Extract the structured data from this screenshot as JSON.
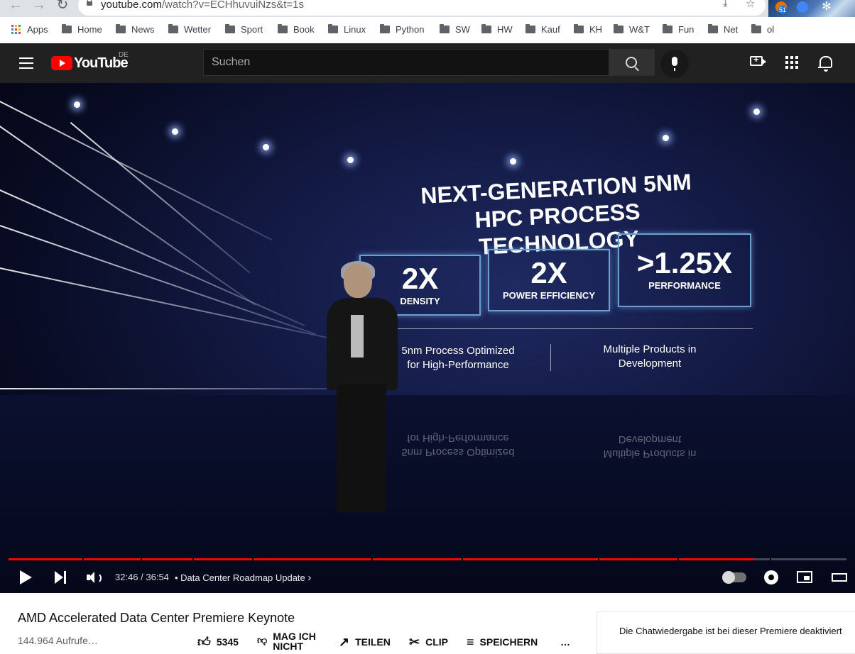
{
  "browser": {
    "url_host": "youtube.com",
    "url_path": "/watch?v=ECHhuvuiNzs&t=1s",
    "extension_badge": "51"
  },
  "bookmarks": [
    {
      "label": "Apps",
      "name": "bookmark-apps"
    },
    {
      "label": "Home",
      "name": "bookmark-home"
    },
    {
      "label": "News",
      "name": "bookmark-news"
    },
    {
      "label": "Wetter",
      "name": "bookmark-wetter"
    },
    {
      "label": "Sport",
      "name": "bookmark-sport"
    },
    {
      "label": "Book",
      "name": "bookmark-book"
    },
    {
      "label": "Linux",
      "name": "bookmark-linux"
    },
    {
      "label": "Python",
      "name": "bookmark-python"
    },
    {
      "label": "SW",
      "name": "bookmark-sw"
    },
    {
      "label": "HW",
      "name": "bookmark-hw"
    },
    {
      "label": "Kauf",
      "name": "bookmark-kauf"
    },
    {
      "label": "KH",
      "name": "bookmark-kh"
    },
    {
      "label": "W&T",
      "name": "bookmark-wt"
    },
    {
      "label": "Fun",
      "name": "bookmark-fun"
    },
    {
      "label": "Net",
      "name": "bookmark-net"
    },
    {
      "label": "ol",
      "name": "bookmark-ol"
    }
  ],
  "youtube": {
    "logo_text": "YouTube",
    "region": "DE",
    "search_placeholder": "Suchen"
  },
  "slide": {
    "title_line1": "NEXT-GENERATION 5NM",
    "title_line2": "HPC PROCESS TECHNOLOGY",
    "stats": [
      {
        "value": "2X",
        "label": "DENSITY"
      },
      {
        "value": "2X",
        "label": "POWER EFFICIENCY"
      },
      {
        "value": ">1.25X",
        "label": "PERFORMANCE"
      }
    ],
    "bullet_left_1": "5nm Process Optimized",
    "bullet_left_2": "for High-Performance",
    "bullet_right_1": "Multiple Products in",
    "bullet_right_2": "Development"
  },
  "player": {
    "current_time": "32:46",
    "duration": "36:54",
    "time_display": "32:46 / 36:54",
    "chapter_title": "Data Center Roadmap Update",
    "progress_fraction": 0.888,
    "colors": {
      "progress": "#ff0000"
    }
  },
  "video": {
    "title": "AMD Accelerated Data Center Premiere Keynote",
    "views": "144.964 Aufrufe…",
    "likes": "5345",
    "dislike_label": "MAG ICH NICHT",
    "share_label": "TEILEN",
    "clip_label": "CLIP",
    "save_label": "SPEICHERN",
    "more_label": "…"
  },
  "chat": {
    "message": "Die Chatwiedergabe ist bei dieser Premiere deaktiviert"
  }
}
